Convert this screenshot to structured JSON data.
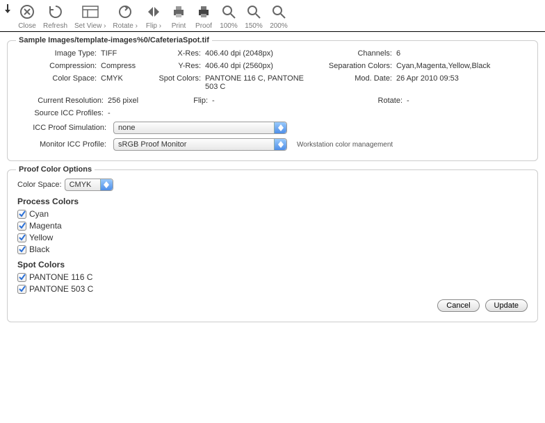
{
  "toolbar": {
    "close": "Close",
    "refresh": "Refresh",
    "setView": "Set View ›",
    "rotate": "Rotate ›",
    "flip": "Flip ›",
    "print": "Print",
    "proof": "Proof",
    "zoom100": "100%",
    "zoom150": "150%",
    "zoom200": "200%"
  },
  "header": {
    "title": "Sample Images/template-images%0/CafeteriaSpot.tif"
  },
  "info": {
    "imageTypeLabel": "Image Type:",
    "imageType": "TIFF",
    "xresLabel": "X-Res:",
    "xres": "406.40 dpi (2048px)",
    "channelsLabel": "Channels:",
    "channels": "6",
    "compressionLabel": "Compression:",
    "compression": "Compress",
    "yresLabel": "Y-Res:",
    "yres": "406.40 dpi (2560px)",
    "sepColorsLabel": "Separation Colors:",
    "sepColors": "Cyan,Magenta,Yellow,Black",
    "colorSpaceLabel": "Color Space:",
    "colorSpace": "CMYK",
    "spotColorsLabel": "Spot Colors:",
    "spotColors": "PANTONE 116 C, PANTONE 503 C",
    "modDateLabel": "Mod. Date:",
    "modDate": "26 Apr 2010 09:53",
    "currentResLabel": "Current Resolution:",
    "currentRes": "256 pixel",
    "flipLabel": "Flip:",
    "flip": "-",
    "rotateLabel": "Rotate:",
    "rotate": "-",
    "sourceIccLabel": "Source ICC Profiles:",
    "sourceIcc": "-",
    "iccProofLabel": "ICC Proof Simulation:",
    "iccProofValue": "none",
    "monitorIccLabel": "Monitor ICC Profile:",
    "monitorIccValue": "sRGB Proof Monitor",
    "wsHint": "Workstation color management"
  },
  "proof": {
    "title": "Proof Color Options",
    "colorSpaceLabel": "Color Space:",
    "colorSpaceValue": "CMYK",
    "processTitle": "Process Colors",
    "process": [
      "Cyan",
      "Magenta",
      "Yellow",
      "Black"
    ],
    "spotTitle": "Spot Colors",
    "spot": [
      "PANTONE 116 C",
      "PANTONE 503 C"
    ],
    "cancel": "Cancel",
    "update": "Update"
  }
}
